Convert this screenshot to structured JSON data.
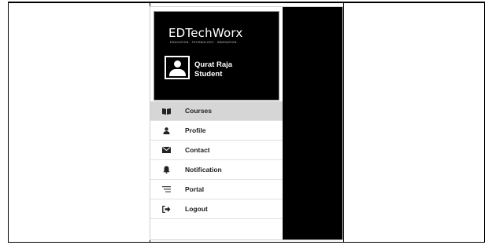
{
  "app": {
    "brand": "EDTechWorx",
    "tagline": "EDUCATION · TECHNOLOGY · INNOVATION"
  },
  "user": {
    "name": "Qurat Raja",
    "role": "Student"
  },
  "menu": {
    "items": [
      {
        "label": "Courses",
        "icon": "book-icon",
        "active": true
      },
      {
        "label": "Profile",
        "icon": "person-icon",
        "active": false
      },
      {
        "label": "Contact",
        "icon": "envelope-icon",
        "active": false
      },
      {
        "label": "Notification",
        "icon": "bell-icon",
        "active": false
      },
      {
        "label": "Portal",
        "icon": "list-icon",
        "active": false
      },
      {
        "label": "Logout",
        "icon": "logout-icon",
        "active": false
      }
    ]
  },
  "colors": {
    "header_bg": "#000000",
    "active_item_bg": "#d6d6d6",
    "scrim": "#000000"
  }
}
